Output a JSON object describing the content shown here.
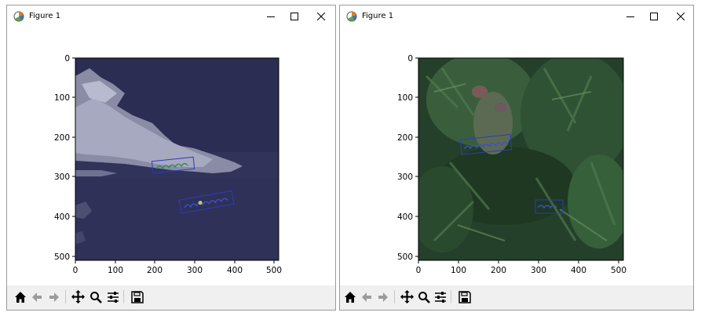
{
  "windows": [
    {
      "title": "Figure 1",
      "image": "grayscale-ice-landscape",
      "xticks": [
        "0",
        "100",
        "200",
        "300",
        "400",
        "500"
      ],
      "yticks": [
        "0",
        "100",
        "200",
        "300",
        "400",
        "500"
      ],
      "detections": [
        {
          "region": "upper-middle",
          "color": "#2a3dbd"
        },
        {
          "region": "lower-right",
          "color": "#2a3dbd"
        }
      ]
    },
    {
      "title": "Figure 1",
      "image": "thuja-foliage-photo",
      "xticks": [
        "0",
        "100",
        "200",
        "300",
        "400",
        "500"
      ],
      "yticks": [
        "0",
        "100",
        "200",
        "300",
        "400",
        "500"
      ],
      "detections": [
        {
          "region": "upper-left",
          "color": "#2a3dbd"
        },
        {
          "region": "lower-right",
          "color": "#2a3dbd"
        }
      ]
    }
  ],
  "window_controls": [
    "minimize-icon",
    "maximize-icon",
    "close-icon"
  ],
  "toolbar_icons": [
    "home-icon",
    "back-arrow-icon",
    "forward-arrow-icon",
    "pan-icon",
    "zoom-icon",
    "configure-subplots-icon",
    "save-icon"
  ],
  "colors": {
    "detection_box": "#2a3dbd",
    "toolbar_bg": "#f0f0f0",
    "window_border": "#9a9a9a"
  }
}
